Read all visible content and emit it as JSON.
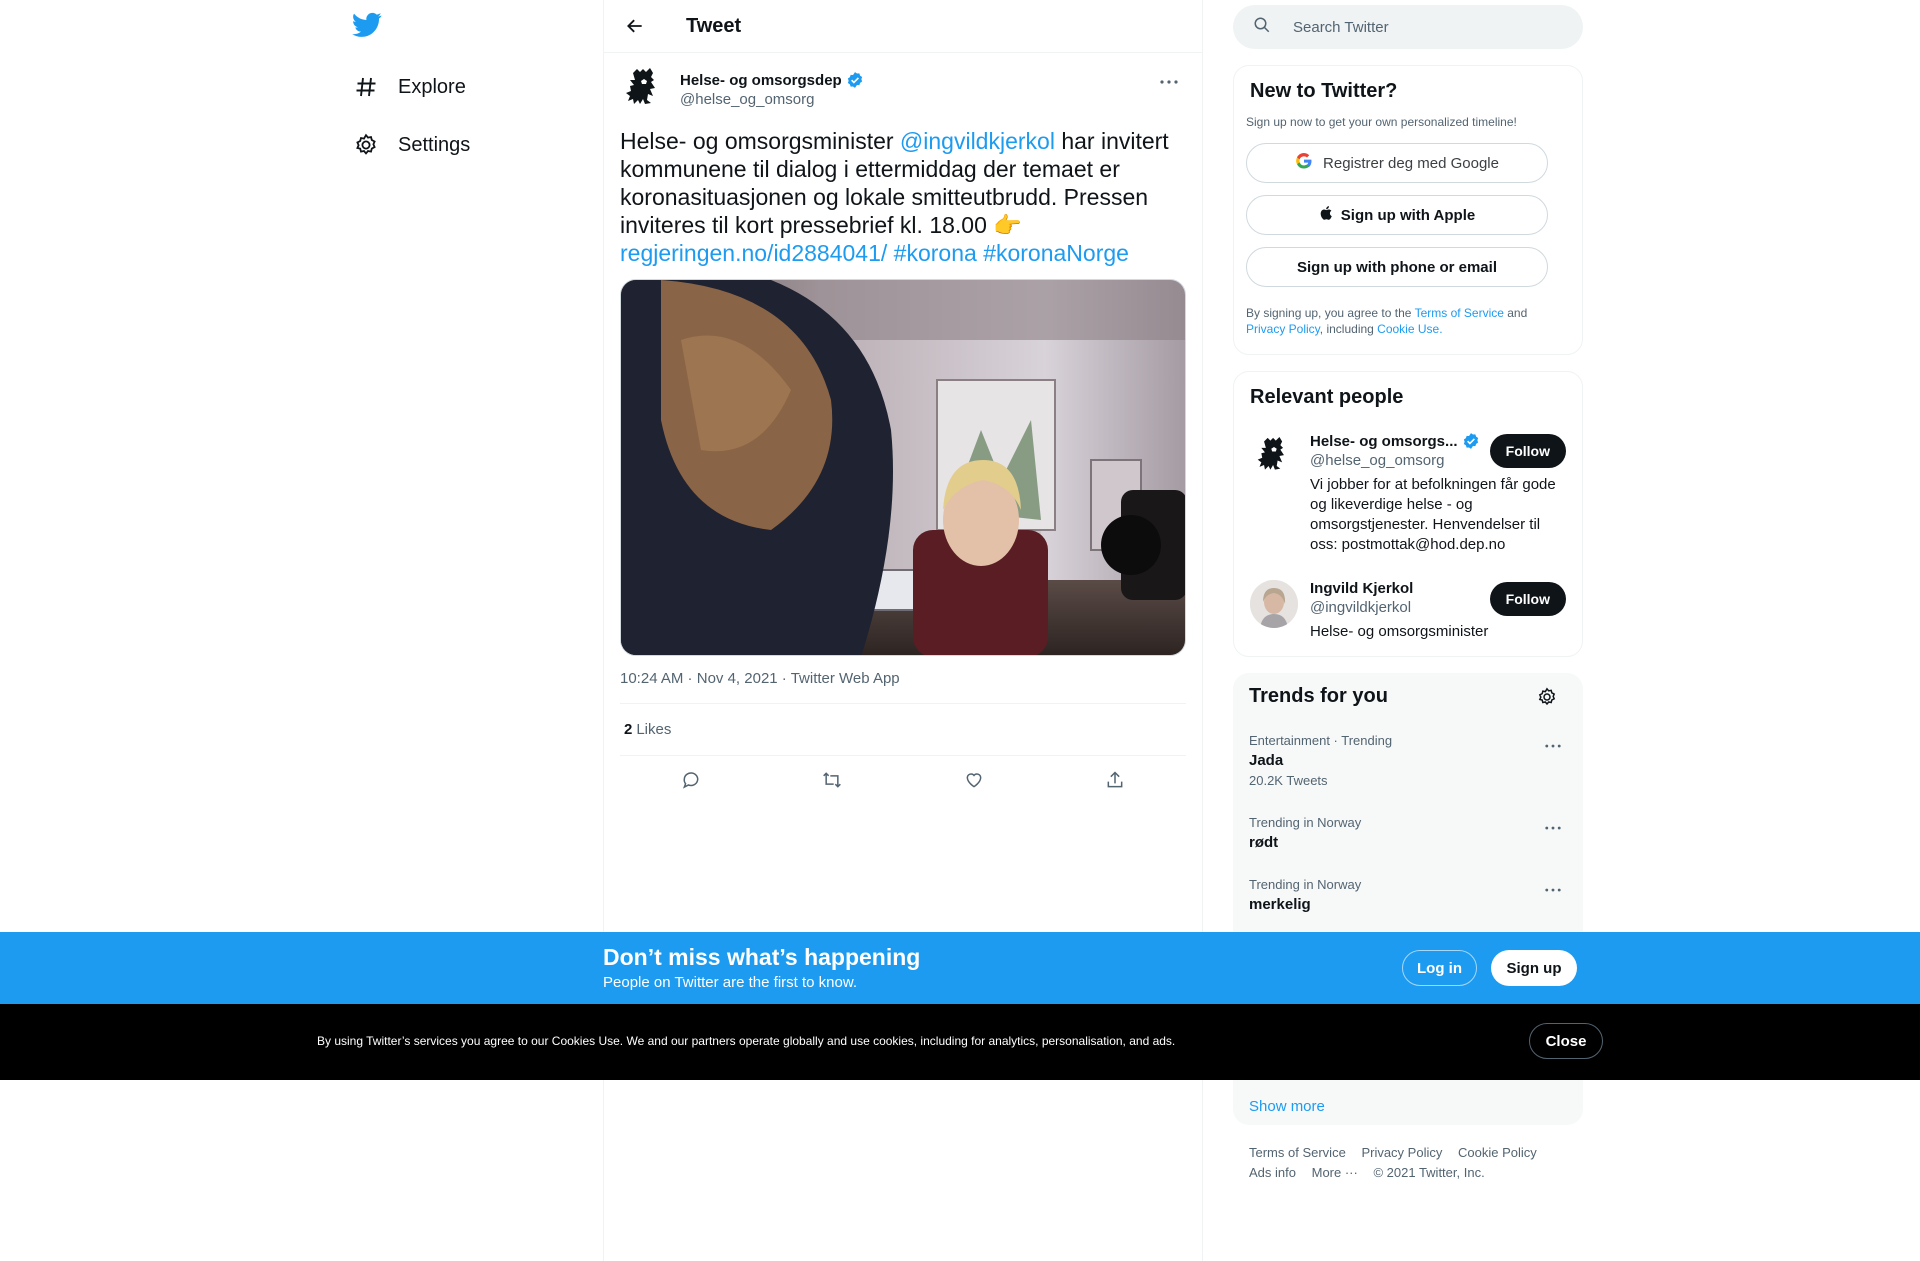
{
  "nav": {
    "items": [
      {
        "label": "Explore",
        "icon": "hashtag-icon"
      },
      {
        "label": "Settings",
        "icon": "gear-icon"
      }
    ]
  },
  "header": {
    "title": "Tweet"
  },
  "tweet": {
    "author_name": "Helse- og omsorgsdep",
    "author_handle": "@helse_og_omsorg",
    "text_1": "Helse- og omsorgsminister ",
    "mention": "@ingvildkjerkol",
    "text_2": " har invitert kommunene til dialog i ettermiddag der temaet er koronasituasjonen og lokale smitteutbrudd. Pressen inviteres til kort pressebrief kl. 18.00 ",
    "emoji": "👉",
    "url": "regjeringen.no/id2884041/",
    "hashtag_1": "#korona",
    "hashtag_2": "#koronaNorge",
    "time": "10:24 AM",
    "sep": " · ",
    "date": "Nov 4, 2021",
    "client": "Twitter Web App",
    "likes_count": "2",
    "likes_label": "Likes"
  },
  "search": {
    "placeholder": "Search Twitter"
  },
  "new_to_twitter": {
    "title": "New to Twitter?",
    "subtitle": "Sign up now to get your own personalized timeline!",
    "google_label": "Registrer deg med Google",
    "apple_label": "Sign up with Apple",
    "phone_label": "Sign up with phone or email",
    "terms_1": "By signing up, you agree to the ",
    "terms_link": "Terms of Service",
    "terms_2": " and ",
    "privacy_link": "Privacy Policy",
    "terms_3": ", including ",
    "cookie_link": "Cookie Use."
  },
  "relevant": {
    "title": "Relevant people",
    "people": [
      {
        "name": "Helse- og omsorgs...",
        "handle": "@helse_og_omsorg",
        "bio": "Vi jobber for at befolkningen får gode og likeverdige helse - og omsorgstjenester. Henvendelser til oss: postmottak@hod.dep.no",
        "follow": "Follow",
        "verified": true
      },
      {
        "name": "Ingvild Kjerkol",
        "handle": "@ingvildkjerkol",
        "bio": "Helse- og omsorgsminister",
        "follow": "Follow",
        "verified": false
      }
    ]
  },
  "trends": {
    "title": "Trends for you",
    "items": [
      {
        "context": "Entertainment · Trending",
        "name": "Jada",
        "count": "20.2K Tweets"
      },
      {
        "context": "Trending in Norway",
        "name": "rødt",
        "count": ""
      },
      {
        "context": "Trending in Norway",
        "name": "merkelig",
        "count": ""
      }
    ],
    "show_more": "Show more"
  },
  "footer": {
    "links": [
      "Terms of Service",
      "Privacy Policy",
      "Cookie Policy"
    ],
    "links2": [
      "Ads info",
      "More ···",
      "© 2021 Twitter, Inc."
    ]
  },
  "banner": {
    "title": "Don’t miss what’s happening",
    "subtitle": "People on Twitter are the first to know.",
    "login": "Log in",
    "signup": "Sign up"
  },
  "cookie": {
    "text": "By using Twitter’s services you agree to our Cookies Use. We and our partners operate globally and use cookies, including for analytics, personalisation, and ads.",
    "close": "Close"
  },
  "colors": {
    "accent": "#1d9bf0",
    "text": "#0f1419",
    "muted": "#536471",
    "banner_bg": "#1d9bf0",
    "cookie_bg": "#000000"
  }
}
